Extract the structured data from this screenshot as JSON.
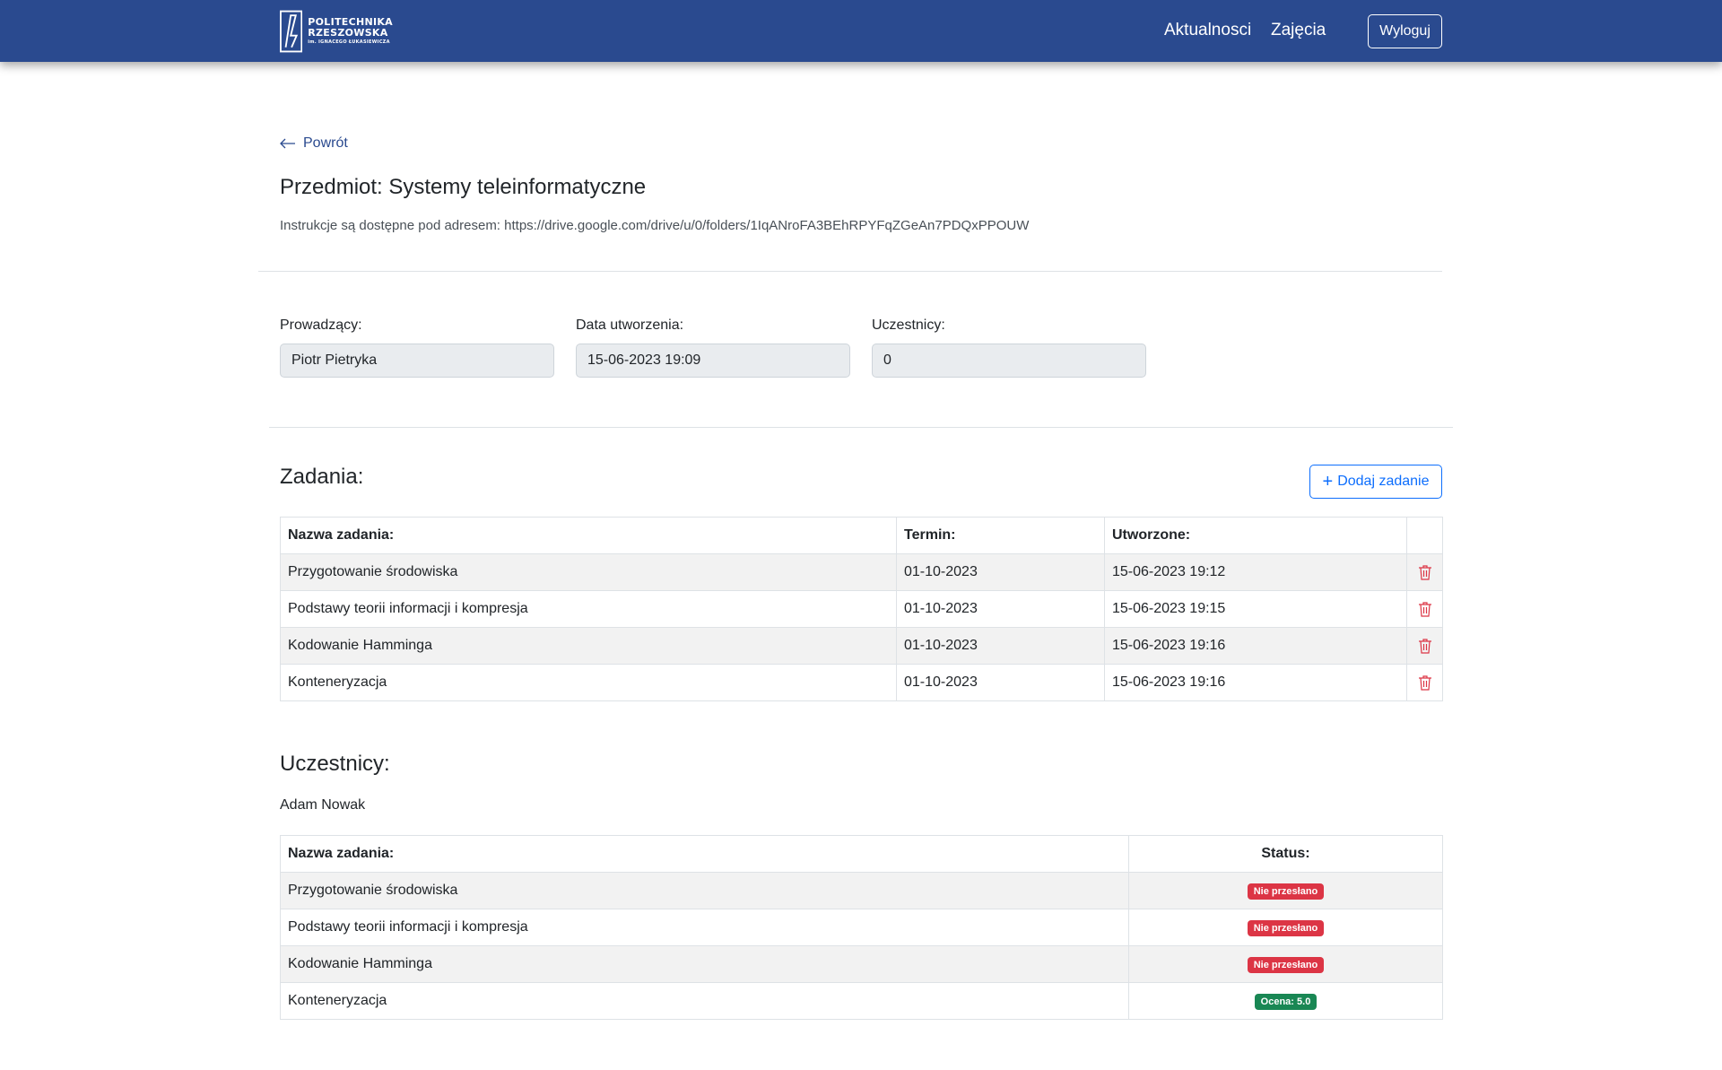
{
  "navbar": {
    "logo": {
      "line1": "POLITECHNIKA",
      "line2": "RZESZOWSKA",
      "line3": "im. IGNACEGO ŁUKASIEWICZA"
    },
    "links": {
      "news": "Aktualnosci",
      "classes": "Zajęcia"
    },
    "logout": "Wyloguj"
  },
  "back": {
    "label": "Powrót",
    "icon": "arrow-left-icon"
  },
  "subject": {
    "title": "Przedmiot: Systemy teleinformatyczne",
    "instructions": "Instrukcje są dostępne pod adresem: https://drive.google.com/drive/u/0/folders/1IqANroFA3BEhRPYFqZGeAn7PDQxPPOUW"
  },
  "fields": {
    "teacher": {
      "label": "Prowadzący:",
      "value": "Piotr Pietryka"
    },
    "created": {
      "label": "Data utworzenia:",
      "value": "15-06-2023 19:09"
    },
    "participants": {
      "label": "Uczestnicy:",
      "value": "0"
    }
  },
  "tasks": {
    "title": "Zadania:",
    "add_button": "Dodaj zadanie",
    "headers": {
      "name": "Nazwa zadania:",
      "deadline": "Termin:",
      "created": "Utworzone:"
    },
    "rows": [
      {
        "name": "Przygotowanie środowiska",
        "deadline": "01-10-2023",
        "created": "15-06-2023 19:12"
      },
      {
        "name": "Podstawy teorii informacji i kompresja",
        "deadline": "01-10-2023",
        "created": "15-06-2023 19:15"
      },
      {
        "name": "Kodowanie Hamminga",
        "deadline": "01-10-2023",
        "created": "15-06-2023 19:16"
      },
      {
        "name": "Konteneryzacja",
        "deadline": "01-10-2023",
        "created": "15-06-2023 19:16"
      }
    ]
  },
  "participants": {
    "title": "Uczestnicy:",
    "name": "Adam Nowak",
    "headers": {
      "name": "Nazwa zadania:",
      "status": "Status:"
    },
    "rows": [
      {
        "name": "Przygotowanie środowiska",
        "status": "Nie przesłano",
        "kind": "missing"
      },
      {
        "name": "Podstawy teorii informacji i kompresja",
        "status": "Nie przesłano",
        "kind": "missing"
      },
      {
        "name": "Kodowanie Hamminga",
        "status": "Nie przesłano",
        "kind": "missing"
      },
      {
        "name": "Konteneryzacja",
        "status": "Ocena: 5.0",
        "kind": "graded"
      }
    ]
  },
  "colors": {
    "navbar": "#2a4a8f",
    "primary": "#0d6efd",
    "danger": "#dc3545",
    "success": "#198754"
  }
}
